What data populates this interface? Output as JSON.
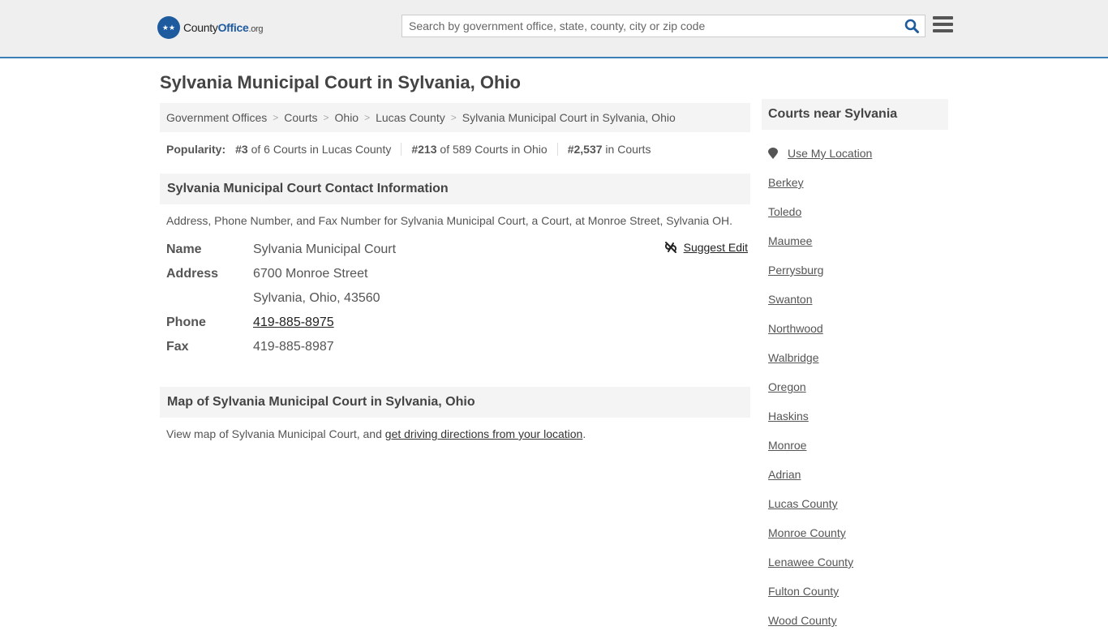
{
  "header": {
    "logo": {
      "part1": "County",
      "part2": "Office",
      "part3": ".org"
    },
    "search_placeholder": "Search by government office, state, county, city or zip code",
    "search_icon": "search-icon",
    "menu_icon": "hamburger-menu-icon"
  },
  "page": {
    "title": "Sylvania Municipal Court in Sylvania, Ohio",
    "breadcrumb": [
      "Government Offices",
      "Courts",
      "Ohio",
      "Lucas County",
      "Sylvania Municipal Court in Sylvania, Ohio"
    ],
    "popularity": {
      "label": "Popularity:",
      "items": [
        {
          "rank": "#3",
          "text": " of 6 Courts in Lucas County"
        },
        {
          "rank": "#213",
          "text": " of 589 Courts in Ohio"
        },
        {
          "rank": "#2,537",
          "text": " in Courts"
        }
      ]
    }
  },
  "contact": {
    "heading": "Sylvania Municipal Court Contact Information",
    "description": "Address, Phone Number, and Fax Number for Sylvania Municipal Court, a Court, at Monroe Street, Sylvania OH.",
    "suggest_edit": "Suggest Edit",
    "fields": {
      "name_label": "Name",
      "name": "Sylvania Municipal Court",
      "address_label": "Address",
      "address1": "6700 Monroe Street",
      "address2": "Sylvania, Ohio, 43560",
      "phone_label": "Phone",
      "phone": "419-885-8975",
      "fax_label": "Fax",
      "fax": "419-885-8987"
    }
  },
  "map": {
    "heading": "Map of Sylvania Municipal Court in Sylvania, Ohio",
    "text_prefix": "View map of Sylvania Municipal Court, and ",
    "link": "get driving directions from your location",
    "text_suffix": "."
  },
  "sidebar": {
    "heading": "Courts near Sylvania",
    "use_location": "Use My Location",
    "items": [
      "Berkey",
      "Toledo",
      "Maumee",
      "Perrysburg",
      "Swanton",
      "Northwood",
      "Walbridge",
      "Oregon",
      "Haskins",
      "Monroe",
      "Adrian",
      "Lucas County",
      "Monroe County",
      "Lenawee County",
      "Fulton County",
      "Wood County"
    ]
  },
  "colors": {
    "brand": "#1d5a9e",
    "header_border": "#3a7fb5"
  }
}
